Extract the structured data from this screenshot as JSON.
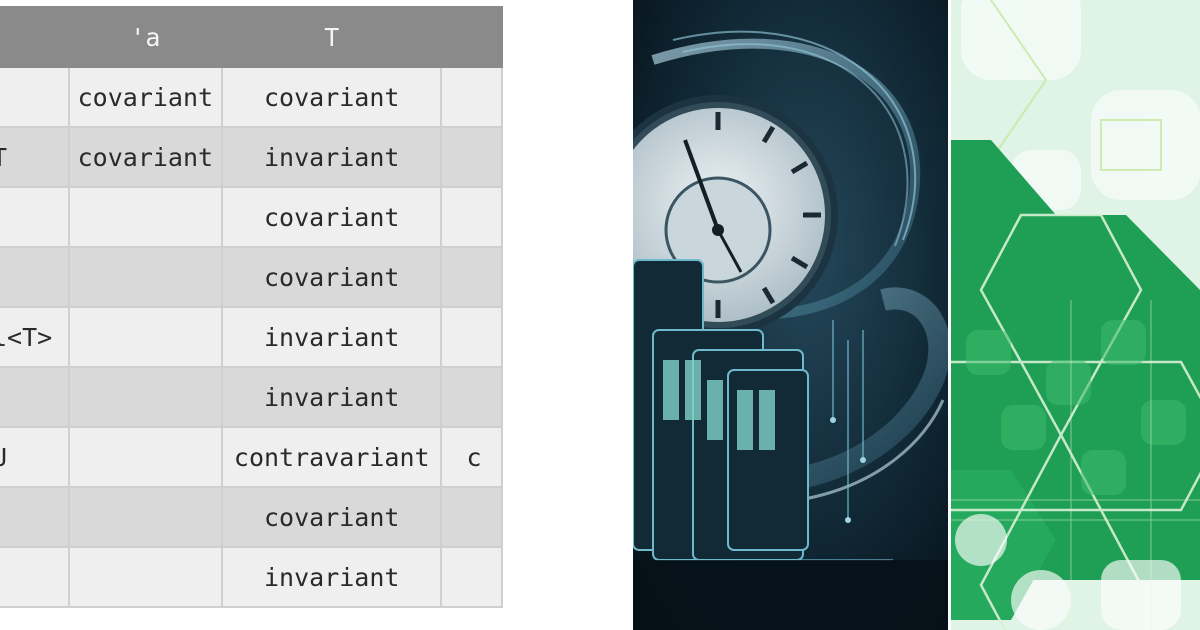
{
  "table": {
    "headers": [
      "",
      "'a",
      "T",
      ""
    ],
    "rows": [
      {
        "type": "",
        "a": "covariant",
        "t": "covariant",
        "extra": ""
      },
      {
        "type": "T",
        "a": "covariant",
        "t": "invariant",
        "extra": ""
      },
      {
        "type": "",
        "a": "",
        "t": "covariant",
        "extra": ""
      },
      {
        "type": "",
        "a": "",
        "t": "covariant",
        "extra": ""
      },
      {
        "type": "l<T>",
        "a": "",
        "t": "invariant",
        "extra": ""
      },
      {
        "type": "",
        "a": "",
        "t": "invariant",
        "extra": ""
      },
      {
        "type": "U",
        "a": "",
        "t": "contravariant",
        "extra": "c"
      },
      {
        "type": "",
        "a": "",
        "t": "covariant",
        "extra": ""
      },
      {
        "type": "",
        "a": "",
        "t": "invariant",
        "extra": ""
      }
    ]
  },
  "images": {
    "clock": "clock-circuit-illustration",
    "hex": "green-hexagon-pattern"
  },
  "colors": {
    "header_bg": "#8a8a8a",
    "row_light": "#efefef",
    "row_dark": "#d9d9d9",
    "hex_green": "#1f9e55"
  }
}
